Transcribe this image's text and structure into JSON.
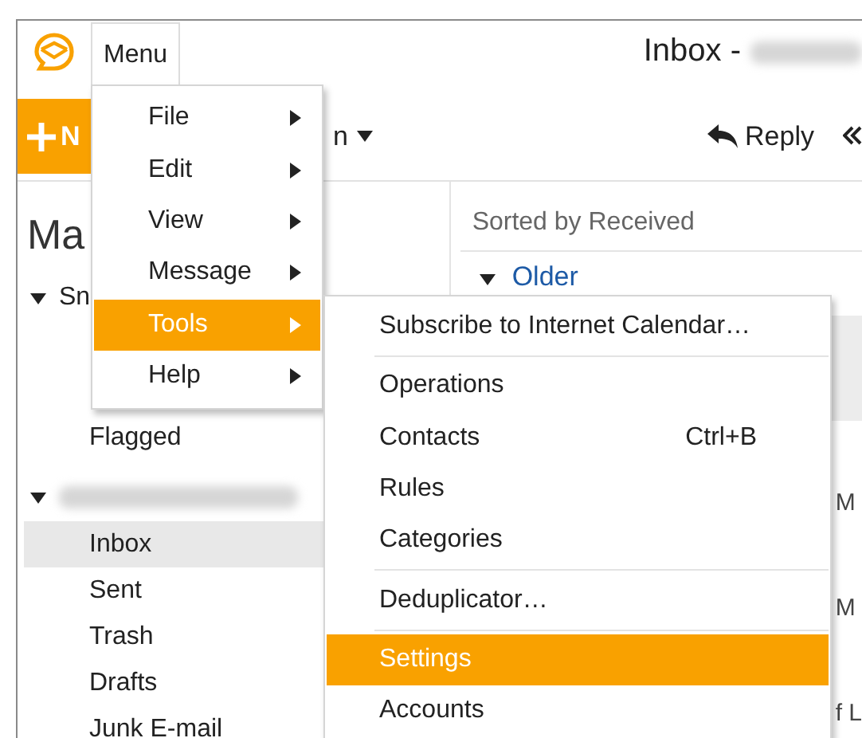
{
  "app": {
    "menu_button": "Menu",
    "title": "Inbox -"
  },
  "toolbar": {
    "new_button": "N",
    "dropdown_label": "n",
    "reply_button": "Reply"
  },
  "sidebar": {
    "heading": "Ma",
    "groups": [
      {
        "label": "Sn",
        "expanded": true,
        "items": [
          {
            "label": "Flagged",
            "selected": false
          }
        ]
      },
      {
        "expanded": true,
        "items": [
          {
            "label": "Inbox",
            "selected": true
          },
          {
            "label": "Sent",
            "selected": false
          },
          {
            "label": "Trash",
            "selected": false
          },
          {
            "label": "Drafts",
            "selected": false
          },
          {
            "label": "Junk E-mail",
            "selected": false
          }
        ]
      }
    ]
  },
  "list": {
    "sort_label": "Sorted by Received",
    "group": "Older",
    "expanded": true,
    "rows": [
      {
        "selected": true
      },
      {
        "snippet": "M",
        "selected": false
      },
      {
        "snippet": "M",
        "selected": false
      },
      {
        "snippet": "f L",
        "selected": false
      }
    ]
  },
  "menu": {
    "items": [
      {
        "label": "File",
        "selected": false,
        "submenu": true
      },
      {
        "label": "Edit",
        "selected": false,
        "submenu": true
      },
      {
        "label": "View",
        "selected": false,
        "submenu": true
      },
      {
        "label": "Message",
        "selected": false,
        "submenu": true
      },
      {
        "label": "Tools",
        "selected": true,
        "submenu": true
      },
      {
        "label": "Help",
        "selected": false,
        "submenu": true
      }
    ]
  },
  "submenu": {
    "items": [
      {
        "kind": "item",
        "label": "Subscribe to Internet Calendar…",
        "selected": false
      },
      {
        "kind": "separator"
      },
      {
        "kind": "item",
        "label": "Operations",
        "selected": false
      },
      {
        "kind": "item",
        "label": "Contacts",
        "shortcut": "Ctrl+B",
        "selected": false
      },
      {
        "kind": "item",
        "label": "Rules",
        "selected": false
      },
      {
        "kind": "item",
        "label": "Categories",
        "selected": false
      },
      {
        "kind": "separator"
      },
      {
        "kind": "item",
        "label": "Deduplicator…",
        "selected": false
      },
      {
        "kind": "separator"
      },
      {
        "kind": "item",
        "label": "Settings",
        "selected": true
      },
      {
        "kind": "item",
        "label": "Accounts",
        "selected": false
      }
    ]
  }
}
